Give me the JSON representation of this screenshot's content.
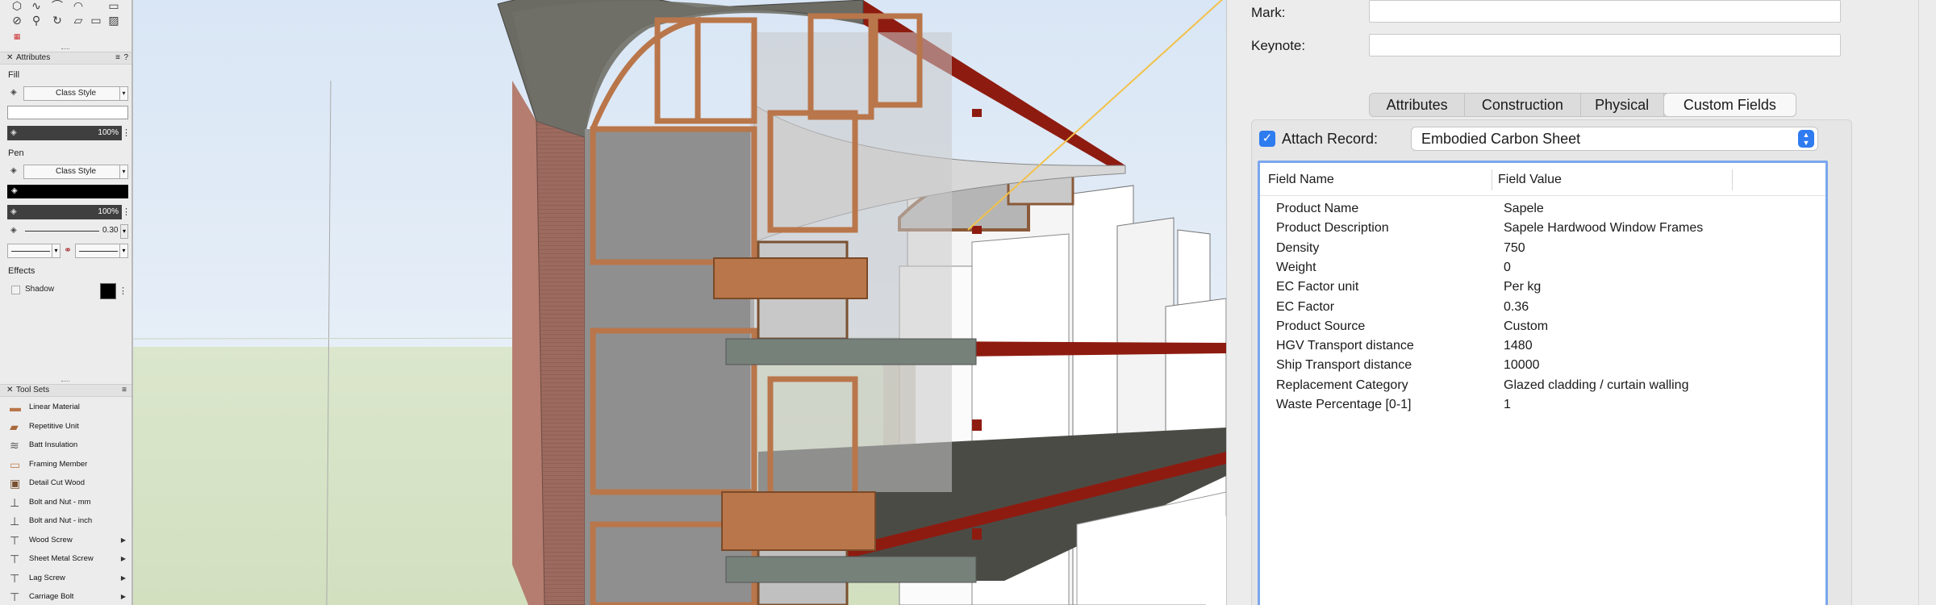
{
  "palettes": {
    "tool_icons": [
      "polygon-tool-icon",
      "freehand-tool-icon",
      "arc-tool-icon",
      "spline-tool-icon",
      "wall-tool-icon",
      "circle-tool-icon",
      "pushpull-tool-icon",
      "rotate-tool-icon",
      "rect-tool-icon",
      "fill-tool-icon",
      "swatch-tool-icon"
    ],
    "attributes": {
      "title": "Attributes",
      "fill_label": "Fill",
      "fill_style": "Class Style",
      "fill_opacity": "100%",
      "pen_label": "Pen",
      "pen_style": "Class Style",
      "pen_opacity": "100%",
      "line_weight": "0.30",
      "effects_label": "Effects",
      "shadow_label": "Shadow"
    },
    "tool_sets": {
      "title": "Tool Sets",
      "items": [
        {
          "label": "Linear Material",
          "icon": "linear-material-icon",
          "has_arrow": false
        },
        {
          "label": "Repetitive Unit",
          "icon": "repetitive-unit-icon",
          "has_arrow": false
        },
        {
          "label": "Batt Insulation",
          "icon": "batt-insulation-icon",
          "has_arrow": false
        },
        {
          "label": "Framing Member",
          "icon": "framing-member-icon",
          "has_arrow": false
        },
        {
          "label": "Detail Cut Wood",
          "icon": "detail-cut-wood-icon",
          "has_arrow": false
        },
        {
          "label": "Bolt and Nut - mm",
          "icon": "bolt-nut-mm-icon",
          "has_arrow": false
        },
        {
          "label": "Bolt and Nut - inch",
          "icon": "bolt-nut-inch-icon",
          "has_arrow": false
        },
        {
          "label": "Wood Screw",
          "icon": "wood-screw-icon",
          "has_arrow": true
        },
        {
          "label": "Sheet Metal Screw",
          "icon": "sheet-metal-screw-icon",
          "has_arrow": true
        },
        {
          "label": "Lag Screw",
          "icon": "lag-screw-icon",
          "has_arrow": true
        },
        {
          "label": "Carriage Bolt",
          "icon": "carriage-bolt-icon",
          "has_arrow": true
        }
      ]
    }
  },
  "object_info": {
    "mark_label": "Mark:",
    "mark_value": "",
    "keynote_label": "Keynote:",
    "keynote_value": "",
    "tabs": [
      "Attributes",
      "Construction",
      "Physical",
      "Custom Fields"
    ],
    "active_tab": "Custom Fields",
    "attach_record_label": "Attach Record:",
    "attach_record_checked": true,
    "record_name": "Embodied Carbon Sheet",
    "table": {
      "headers": [
        "Field Name",
        "Field Value"
      ],
      "rows": [
        {
          "name": "Product Name",
          "value": "Sapele"
        },
        {
          "name": "Product Description",
          "value": "Sapele Hardwood Window Frames"
        },
        {
          "name": "Density",
          "value": "750"
        },
        {
          "name": "Weight",
          "value": "0"
        },
        {
          "name": "EC Factor unit",
          "value": "Per kg"
        },
        {
          "name": "EC Factor",
          "value": "0.36"
        },
        {
          "name": "Product Source",
          "value": "Custom"
        },
        {
          "name": "HGV Transport distance",
          "value": "1480"
        },
        {
          "name": "Ship Transport distance",
          "value": "10000"
        },
        {
          "name": "Replacement Category",
          "value": "Glazed cladding / curtain walling"
        },
        {
          "name": "Waste Percentage [0-1]",
          "value": "1"
        }
      ]
    }
  },
  "colors": {
    "accent_blue": "#2f7bf0",
    "selection_line": "#f2c14a",
    "beam_red": "#8e1b10",
    "wood": "#b9764a"
  }
}
